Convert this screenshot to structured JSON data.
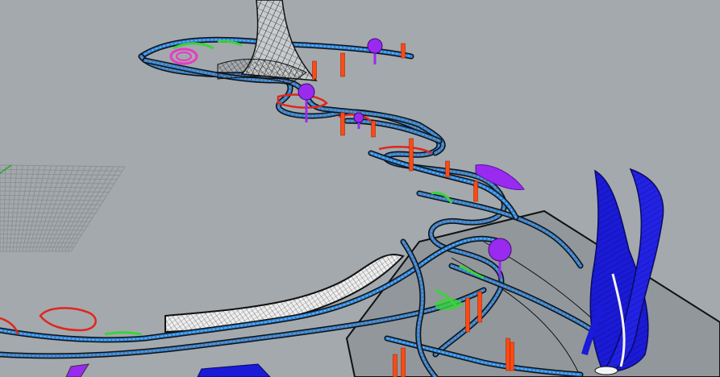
{
  "viewport": {
    "background": "#a4a9ad",
    "grid_color": "#8c9196",
    "grid_axis_color": "#2aa52a"
  },
  "palette": {
    "wireframe": "#111111",
    "mesh_fill": "#8e9397",
    "curve_blue": "#2a7fd4",
    "curve_light_blue": "#6fb6ec",
    "highlight_green": "#39d43a",
    "highlight_red": "#e0261c",
    "highlight_magenta": "#e83ac4",
    "highlight_purple": "#9a2af0",
    "support_orange": "#ff4a12",
    "tower_blue": "#1a1ad8",
    "tower_white": "#f4f4f4"
  },
  "objects": [
    "perspective-construction-grid",
    "winding-ribbon-path-network",
    "conical-lattice-tower",
    "twin-twisted-blue-towers",
    "orange-support-columns",
    "purple-node-markers",
    "white-ribbon-surface"
  ]
}
